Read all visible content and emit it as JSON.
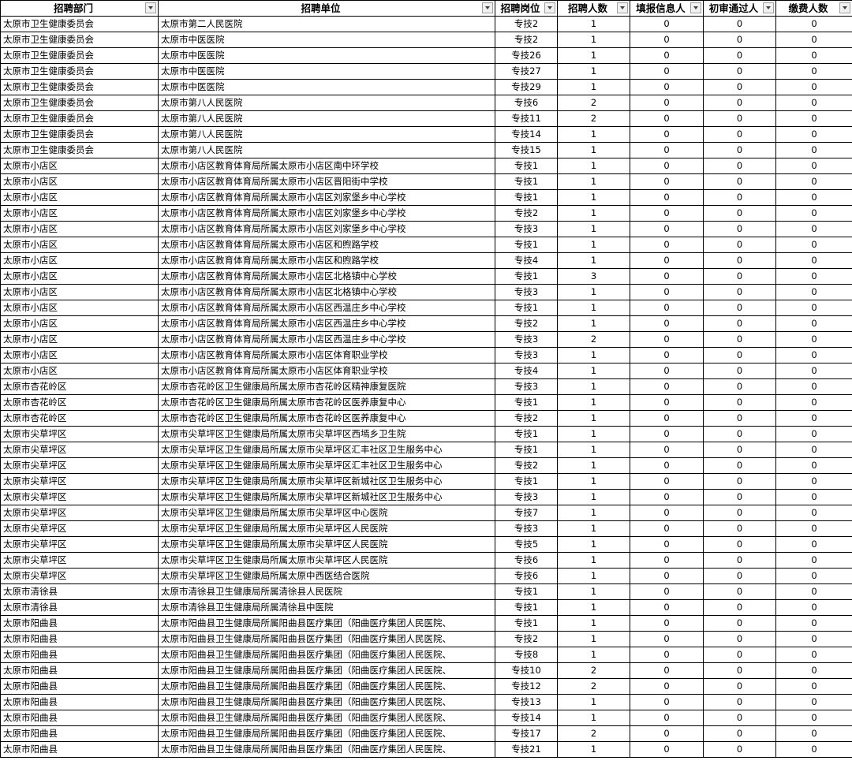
{
  "headers": [
    "招聘部门",
    "招聘单位",
    "招聘岗位",
    "招聘人数",
    "填报信息人数",
    "初审通过人数",
    "缴费人数"
  ],
  "header_display": [
    "招聘部门",
    "招聘单位",
    "招聘岗位",
    "招聘人数",
    "填报信息人",
    "初审通过人",
    "缴费人数"
  ],
  "rows": [
    [
      "太原市卫生健康委员会",
      "太原市第二人民医院",
      "专技2",
      "1",
      "0",
      "0",
      "0"
    ],
    [
      "太原市卫生健康委员会",
      "太原市中医医院",
      "专技2",
      "1",
      "0",
      "0",
      "0"
    ],
    [
      "太原市卫生健康委员会",
      "太原市中医医院",
      "专技26",
      "1",
      "0",
      "0",
      "0"
    ],
    [
      "太原市卫生健康委员会",
      "太原市中医医院",
      "专技27",
      "1",
      "0",
      "0",
      "0"
    ],
    [
      "太原市卫生健康委员会",
      "太原市中医医院",
      "专技29",
      "1",
      "0",
      "0",
      "0"
    ],
    [
      "太原市卫生健康委员会",
      "太原市第八人民医院",
      "专技6",
      "2",
      "0",
      "0",
      "0"
    ],
    [
      "太原市卫生健康委员会",
      "太原市第八人民医院",
      "专技11",
      "2",
      "0",
      "0",
      "0"
    ],
    [
      "太原市卫生健康委员会",
      "太原市第八人民医院",
      "专技14",
      "1",
      "0",
      "0",
      "0"
    ],
    [
      "太原市卫生健康委员会",
      "太原市第八人民医院",
      "专技15",
      "1",
      "0",
      "0",
      "0"
    ],
    [
      "太原市小店区",
      "太原市小店区教育体育局所属太原市小店区南中环学校",
      "专技1",
      "1",
      "0",
      "0",
      "0"
    ],
    [
      "太原市小店区",
      "太原市小店区教育体育局所属太原市小店区晋阳街中学校",
      "专技1",
      "1",
      "0",
      "0",
      "0"
    ],
    [
      "太原市小店区",
      "太原市小店区教育体育局所属太原市小店区刘家堡乡中心学校",
      "专技1",
      "1",
      "0",
      "0",
      "0"
    ],
    [
      "太原市小店区",
      "太原市小店区教育体育局所属太原市小店区刘家堡乡中心学校",
      "专技2",
      "1",
      "0",
      "0",
      "0"
    ],
    [
      "太原市小店区",
      "太原市小店区教育体育局所属太原市小店区刘家堡乡中心学校",
      "专技3",
      "1",
      "0",
      "0",
      "0"
    ],
    [
      "太原市小店区",
      "太原市小店区教育体育局所属太原市小店区和煦路学校",
      "专技1",
      "1",
      "0",
      "0",
      "0"
    ],
    [
      "太原市小店区",
      "太原市小店区教育体育局所属太原市小店区和煦路学校",
      "专技4",
      "1",
      "0",
      "0",
      "0"
    ],
    [
      "太原市小店区",
      "太原市小店区教育体育局所属太原市小店区北格镇中心学校",
      "专技1",
      "3",
      "0",
      "0",
      "0"
    ],
    [
      "太原市小店区",
      "太原市小店区教育体育局所属太原市小店区北格镇中心学校",
      "专技3",
      "1",
      "0",
      "0",
      "0"
    ],
    [
      "太原市小店区",
      "太原市小店区教育体育局所属太原市小店区西温庄乡中心学校",
      "专技1",
      "1",
      "0",
      "0",
      "0"
    ],
    [
      "太原市小店区",
      "太原市小店区教育体育局所属太原市小店区西温庄乡中心学校",
      "专技2",
      "1",
      "0",
      "0",
      "0"
    ],
    [
      "太原市小店区",
      "太原市小店区教育体育局所属太原市小店区西温庄乡中心学校",
      "专技3",
      "2",
      "0",
      "0",
      "0"
    ],
    [
      "太原市小店区",
      "太原市小店区教育体育局所属太原市小店区体育职业学校",
      "专技3",
      "1",
      "0",
      "0",
      "0"
    ],
    [
      "太原市小店区",
      "太原市小店区教育体育局所属太原市小店区体育职业学校",
      "专技4",
      "1",
      "0",
      "0",
      "0"
    ],
    [
      "太原市杏花岭区",
      "太原市杏花岭区卫生健康局所属太原市杏花岭区精神康复医院",
      "专技3",
      "1",
      "0",
      "0",
      "0"
    ],
    [
      "太原市杏花岭区",
      "太原市杏花岭区卫生健康局所属太原市杏花岭区医养康复中心",
      "专技1",
      "1",
      "0",
      "0",
      "0"
    ],
    [
      "太原市杏花岭区",
      "太原市杏花岭区卫生健康局所属太原市杏花岭区医养康复中心",
      "专技2",
      "1",
      "0",
      "0",
      "0"
    ],
    [
      "太原市尖草坪区",
      "太原市尖草坪区卫生健康局所属太原市尖草坪区西墕乡卫生院",
      "专技1",
      "1",
      "0",
      "0",
      "0"
    ],
    [
      "太原市尖草坪区",
      "太原市尖草坪区卫生健康局所属太原市尖草坪区汇丰社区卫生服务中心",
      "专技1",
      "1",
      "0",
      "0",
      "0"
    ],
    [
      "太原市尖草坪区",
      "太原市尖草坪区卫生健康局所属太原市尖草坪区汇丰社区卫生服务中心",
      "专技2",
      "1",
      "0",
      "0",
      "0"
    ],
    [
      "太原市尖草坪区",
      "太原市尖草坪区卫生健康局所属太原市尖草坪区新城社区卫生服务中心",
      "专技1",
      "1",
      "0",
      "0",
      "0"
    ],
    [
      "太原市尖草坪区",
      "太原市尖草坪区卫生健康局所属太原市尖草坪区新城社区卫生服务中心",
      "专技3",
      "1",
      "0",
      "0",
      "0"
    ],
    [
      "太原市尖草坪区",
      "太原市尖草坪区卫生健康局所属太原市尖草坪区中心医院",
      "专技7",
      "1",
      "0",
      "0",
      "0"
    ],
    [
      "太原市尖草坪区",
      "太原市尖草坪区卫生健康局所属太原市尖草坪区人民医院",
      "专技3",
      "1",
      "0",
      "0",
      "0"
    ],
    [
      "太原市尖草坪区",
      "太原市尖草坪区卫生健康局所属太原市尖草坪区人民医院",
      "专技5",
      "1",
      "0",
      "0",
      "0"
    ],
    [
      "太原市尖草坪区",
      "太原市尖草坪区卫生健康局所属太原市尖草坪区人民医院",
      "专技6",
      "1",
      "0",
      "0",
      "0"
    ],
    [
      "太原市尖草坪区",
      "太原市尖草坪区卫生健康局所属太原中西医结合医院",
      "专技6",
      "1",
      "0",
      "0",
      "0"
    ],
    [
      "太原市清徐县",
      "太原市清徐县卫生健康局所属清徐县人民医院",
      "专技1",
      "1",
      "0",
      "0",
      "0"
    ],
    [
      "太原市清徐县",
      "太原市清徐县卫生健康局所属清徐县中医院",
      "专技1",
      "1",
      "0",
      "0",
      "0"
    ],
    [
      "太原市阳曲县",
      "太原市阳曲县卫生健康局所属阳曲县医疗集团（阳曲医疗集团人民医院、",
      "专技1",
      "1",
      "0",
      "0",
      "0"
    ],
    [
      "太原市阳曲县",
      "太原市阳曲县卫生健康局所属阳曲县医疗集团（阳曲医疗集团人民医院、",
      "专技2",
      "1",
      "0",
      "0",
      "0"
    ],
    [
      "太原市阳曲县",
      "太原市阳曲县卫生健康局所属阳曲县医疗集团（阳曲医疗集团人民医院、",
      "专技8",
      "1",
      "0",
      "0",
      "0"
    ],
    [
      "太原市阳曲县",
      "太原市阳曲县卫生健康局所属阳曲县医疗集团（阳曲医疗集团人民医院、",
      "专技10",
      "2",
      "0",
      "0",
      "0"
    ],
    [
      "太原市阳曲县",
      "太原市阳曲县卫生健康局所属阳曲县医疗集团（阳曲医疗集团人民医院、",
      "专技12",
      "2",
      "0",
      "0",
      "0"
    ],
    [
      "太原市阳曲县",
      "太原市阳曲县卫生健康局所属阳曲县医疗集团（阳曲医疗集团人民医院、",
      "专技13",
      "1",
      "0",
      "0",
      "0"
    ],
    [
      "太原市阳曲县",
      "太原市阳曲县卫生健康局所属阳曲县医疗集团（阳曲医疗集团人民医院、",
      "专技14",
      "1",
      "0",
      "0",
      "0"
    ],
    [
      "太原市阳曲县",
      "太原市阳曲县卫生健康局所属阳曲县医疗集团（阳曲医疗集团人民医院、",
      "专技17",
      "2",
      "0",
      "0",
      "0"
    ],
    [
      "太原市阳曲县",
      "太原市阳曲县卫生健康局所属阳曲县医疗集团（阳曲医疗集团人民医院、",
      "专技21",
      "1",
      "0",
      "0",
      "0"
    ]
  ]
}
